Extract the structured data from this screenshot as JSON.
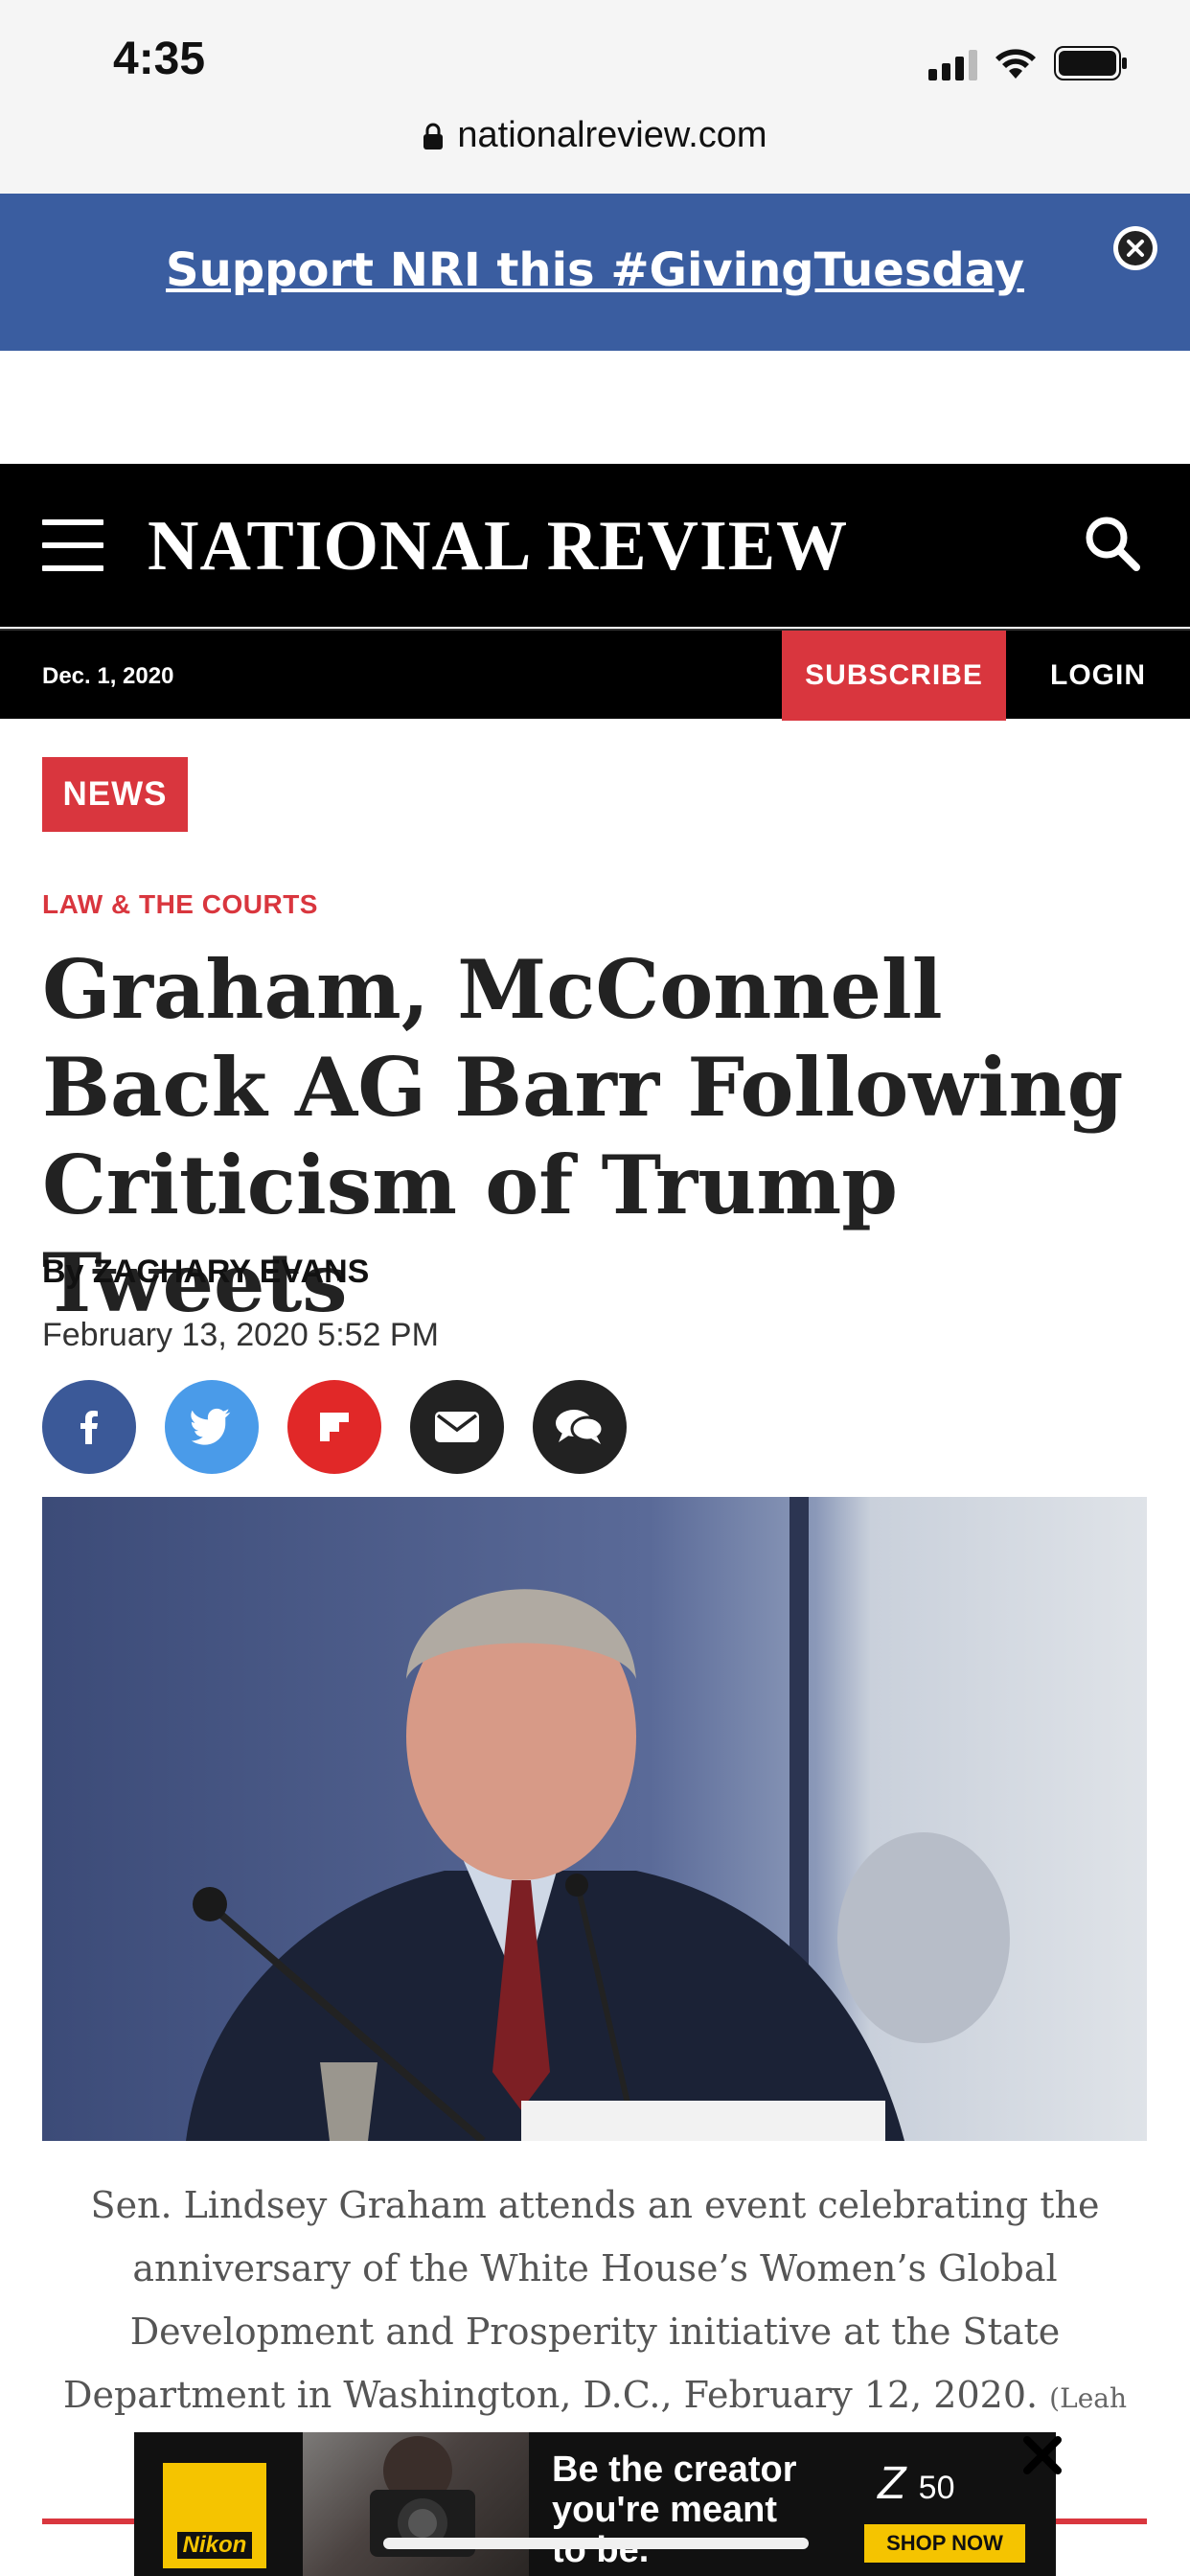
{
  "status_bar": {
    "time": "4:35"
  },
  "browser": {
    "url": "nationalreview.com"
  },
  "promo": {
    "text": "Support NRI this #GivingTuesday"
  },
  "header": {
    "logo": "NATIONAL REVIEW",
    "date": "Dec. 1, 2020",
    "subscribe_label": "SUBSCRIBE",
    "login_label": "LOGIN"
  },
  "article": {
    "tag": "NEWS",
    "section": "LAW & THE COURTS",
    "headline": "Graham, McConnell Back AG Barr Following Criticism of Trump Tweets",
    "byline_prefix": "By",
    "author": "ZACHARY EVANS",
    "timestamp": "February 13, 2020 5:52 PM",
    "caption": "Sen. Lindsey Graham attends an event celebrating the anniversary of the White House’s Women’s Global Development and Prosperity initiative at the State Department in Washington, D.C., February 12, 2020.",
    "caption_credit": "(Leah"
  },
  "share_buttons": [
    {
      "name": "facebook",
      "color": "#3b5998"
    },
    {
      "name": "twitter",
      "color": "#4a9be9"
    },
    {
      "name": "flipboard",
      "color": "#e12828"
    },
    {
      "name": "email",
      "color": "#222222"
    },
    {
      "name": "comments",
      "color": "#222222"
    }
  ],
  "ad": {
    "brand": "Nikon",
    "line1": "Be the creator",
    "line2": "you're meant",
    "line3": "to be.",
    "model": "Z",
    "model_number": "50",
    "cta": "SHOP NOW"
  },
  "colors": {
    "accent_red": "#d9363e",
    "promo_blue": "#3a5da0"
  }
}
